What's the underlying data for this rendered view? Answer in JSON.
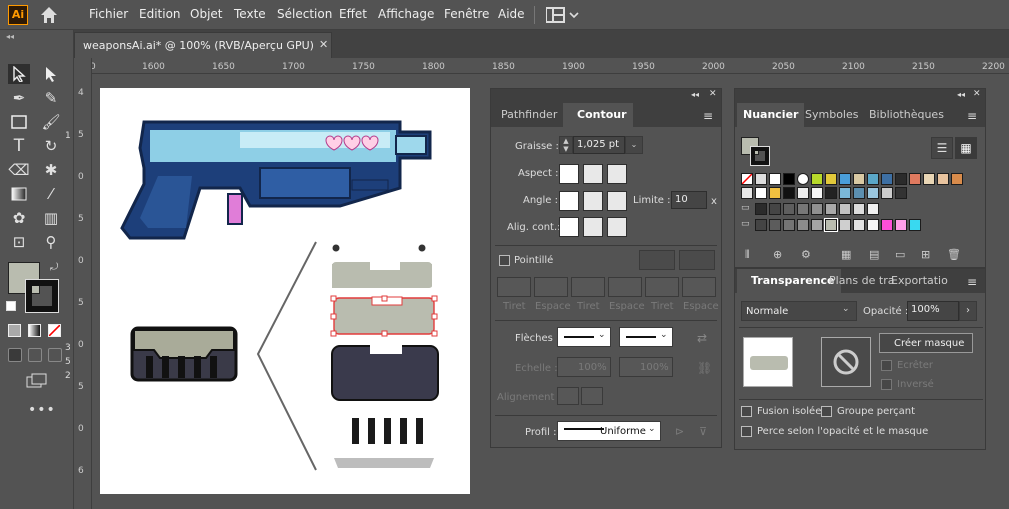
{
  "app": {
    "logo": "Ai"
  },
  "menu": [
    "Fichier",
    "Edition",
    "Objet",
    "Texte",
    "Sélection",
    "Effet",
    "Affichage",
    "Fenêtre",
    "Aide"
  ],
  "toolbar": {
    "stroke_labels": [
      "1",
      "3",
      "5",
      "2"
    ]
  },
  "document": {
    "tab_title": "weaponsAi.ai* @ 100% (RVB/Aperçu GPU)"
  },
  "ruler": {
    "h_ticks": [
      "0",
      "1600",
      "1650",
      "1700",
      "1750",
      "1800",
      "1850",
      "1900",
      "1950",
      "2000",
      "2050",
      "2100",
      "2150",
      "2200"
    ],
    "v_ticks": [
      "4",
      "5",
      "0",
      "5",
      "0",
      "5",
      "0",
      "5",
      "0",
      "6"
    ]
  },
  "contour_panel": {
    "tabs": [
      "Pathfinder",
      "Contour"
    ],
    "weight_label": "Graisse :",
    "weight_value": "1,025 pt",
    "cap_label": "Aspect :",
    "corner_label": "Angle :",
    "limit_label": "Limite :",
    "limit_value": "10",
    "limit_unit": "x",
    "align_label": "Alig. cont.:",
    "dashed_label": "Pointillé",
    "dash_cols": [
      "Tiret",
      "Espace",
      "Tiret",
      "Espace",
      "Tiret",
      "Espace"
    ],
    "arrows_label": "Flèches :",
    "scale_label": "Echelle :",
    "scale1": "100%",
    "scale2": "100%",
    "alignment_label": "Alignement :",
    "profile_label": "Profil :",
    "profile_value": "Uniforme"
  },
  "swatch_panel": {
    "tabs": [
      "Nuancier",
      "Symboles",
      "Bibliothèques"
    ]
  },
  "transparency_panel": {
    "tabs": [
      "Transparence",
      "Plans de tra",
      "Exportatio"
    ],
    "blend_mode": "Normale",
    "opacity_label": "Opacité :",
    "opacity_value": "100%",
    "make_mask": "Créer masque",
    "clip": "Ecrêter",
    "invert": "Inversé",
    "isolate": "Fusion isolée",
    "knockout": "Groupe perçant",
    "define_knockout": "Perce selon l'opacité et le masque"
  }
}
